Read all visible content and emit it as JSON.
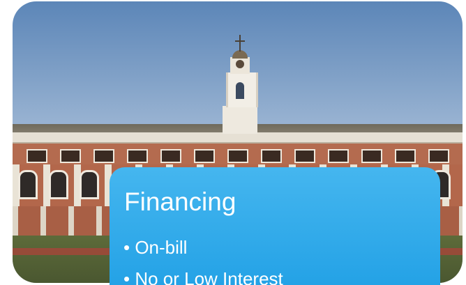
{
  "callout": {
    "title": "Financing",
    "bullets": [
      "• On-bill",
      "• No or Low Interest"
    ]
  },
  "colors": {
    "callout_background": "#2ba6e8",
    "callout_text": "#ffffff"
  }
}
